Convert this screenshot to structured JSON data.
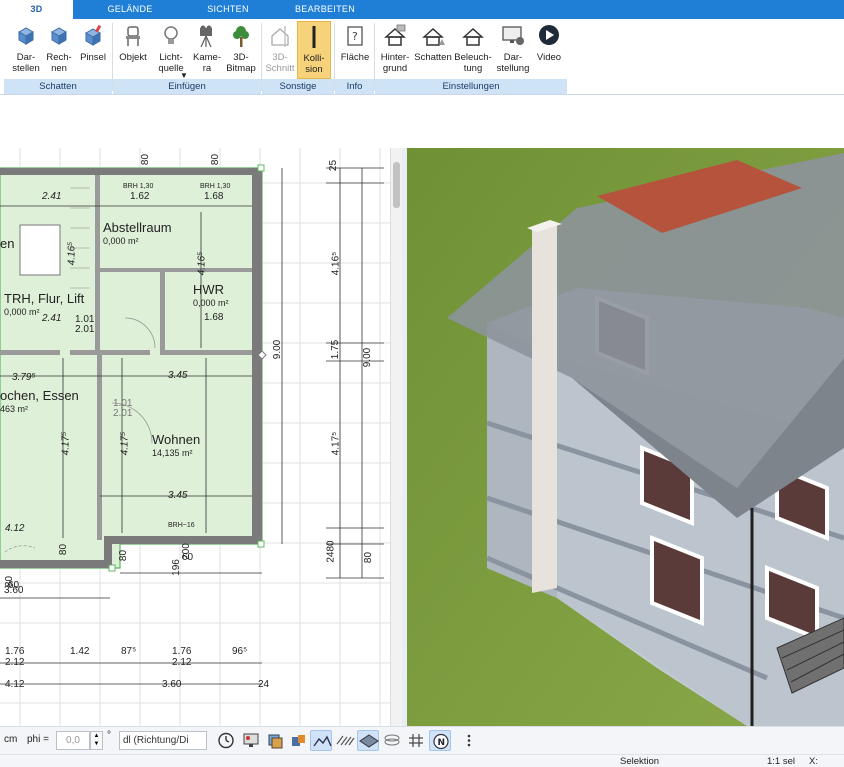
{
  "ribbon": {
    "tabs": [
      {
        "label": "3D",
        "active": true
      },
      {
        "label": "GELÄNDE",
        "active": false
      },
      {
        "label": "SICHTEN",
        "active": false
      },
      {
        "label": "BEARBEITEN",
        "active": false
      }
    ],
    "buttons": {
      "darstellen": "Dar-\nstellen",
      "rechnen": "Rech-\nnen",
      "pinsel": "Pinsel",
      "objekt": "Objekt",
      "lichtquelle": "Licht-\nquelle",
      "kamera": "Kame-\nra",
      "bitmap3d": "3D-\nBitmap",
      "schnitt3d": "3D-\nSchnitt",
      "kollision": "Kolli-\nsion",
      "flaeche": "Fläche",
      "hintergrund": "Hinter-\ngrund",
      "schatten": "Schatten",
      "beleuchtung": "Beleuch-\ntung",
      "darstellung": "Dar-\nstellung",
      "video": "Video"
    },
    "groups": {
      "schatten": "Schatten",
      "einfuegen": "Einfügen",
      "sonstige": "Sonstige",
      "info": "Info",
      "einstellungen": "Einstellungen"
    }
  },
  "plan": {
    "rooms": {
      "abstellraum_name": "Abstellraum",
      "abstellraum_area": "0,000 m²",
      "hwr_name": "HWR",
      "hwr_area": "0,000 m²",
      "trh_name": "TRH, Flur, Lift",
      "trh_area": "0,000 m²",
      "kochen_name": "ochen, Essen",
      "kochen_area": "463 m²",
      "wohnen_name": "Wohnen",
      "wohnen_area": "14,135 m²",
      "en_name": "en"
    },
    "dims": {
      "d_241a": "2.41",
      "d_162": "1.62",
      "d_168a": "1.68",
      "d_brh130a": "BRH 1,30",
      "d_brh130b": "BRH 1,30",
      "d_241b": "2.41",
      "d_101a": "1.01",
      "d_201a": "2.01",
      "d_168b": "1.68",
      "d_3795": "3.79⁵",
      "d_345a": "3.45",
      "d_101b": "1.01",
      "d_201b": "2.01",
      "d_345b": "3.45",
      "d_412a": "4.12",
      "d_brh16": "BRH~16",
      "d_900a": "9.00",
      "d_900b": "9.00",
      "d_4165": "4.16⁵",
      "d_175": "1.75",
      "d_4175": "4.17⁵",
      "d_25": "25",
      "d_80a": "80",
      "d_80b": "80",
      "d_2480": "2480",
      "d_80c": "80",
      "d_80d": "80",
      "d_80e": "80",
      "d_60": "60",
      "d_200": "200",
      "d_196": "196",
      "d_360": "3.60",
      "d_bot_176a": "1.76",
      "d_bot_142": "1.42",
      "d_bot_875": "87⁵",
      "d_bot_176b": "1.76",
      "d_bot_965": "96⁵",
      "d_bot_212a": "2.12",
      "d_bot_212b": "2.12",
      "d_bot_412": "4.12",
      "d_bot_360": "3.60",
      "d_bot_24": "24",
      "d_left_80": "80",
      "d_left_60": "60",
      "d_416a": "4.16⁵",
      "d_4175b": "4.17⁵",
      "d_4175c": "4.17⁵",
      "d_4165b": "4.16⁵"
    }
  },
  "bottombar": {
    "unit": "cm",
    "phi_label": "phi =",
    "phi_value": "0,0",
    "degree": "°",
    "combo_value": "dl (Richtung/Di"
  },
  "status": {
    "mode": "Selektion",
    "selection": "1:1 sel",
    "x_label": "X:"
  },
  "colors": {
    "ribbon_blue": "#1f7fd6",
    "group_label_bg": "#cfe3f6",
    "room_fill": "#dff0d8",
    "wall_fill": "#7a7a7a",
    "grass": "#7a9a36",
    "active_button": "#f6d27a"
  }
}
